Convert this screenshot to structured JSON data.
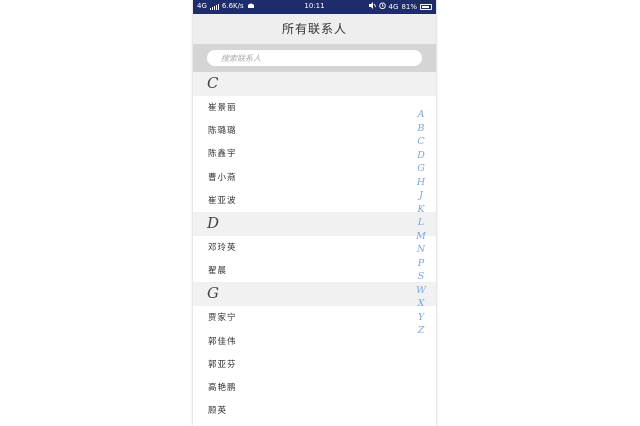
{
  "status_bar": {
    "network": "4G",
    "speed": "6.6K/s",
    "time": "10:11",
    "right_network": "4G",
    "battery": "81%",
    "icons": [
      "signal-bars-icon",
      "android-icon",
      "mute-icon",
      "alarm-icon",
      "battery-icon"
    ]
  },
  "header": {
    "title": "所有联系人"
  },
  "search": {
    "placeholder": "搜索联系人"
  },
  "sections": [
    {
      "letter": "C",
      "contacts": [
        "崔景丽",
        "陈璐璐",
        "陈鑫宇",
        "曹小燕",
        "崔亚波"
      ]
    },
    {
      "letter": "D",
      "contacts": [
        "邓玲英",
        "翟晨"
      ]
    },
    {
      "letter": "G",
      "contacts": [
        "贾家宁",
        "郭佳伟",
        "郭亚芬",
        "高艳鹏",
        "顾英"
      ]
    }
  ],
  "index_letters": [
    "A",
    "B",
    "C",
    "D",
    "G",
    "H",
    "J",
    "K",
    "L",
    "M",
    "N",
    "P",
    "S",
    "W",
    "X",
    "Y",
    "Z"
  ],
  "colors": {
    "status_bar": "#1e2c6b",
    "title_bar": "#eeeeee",
    "search_bg": "#d5d5d5",
    "section_header": "#f1f1f1",
    "index_accent": "#7ba7dc"
  }
}
